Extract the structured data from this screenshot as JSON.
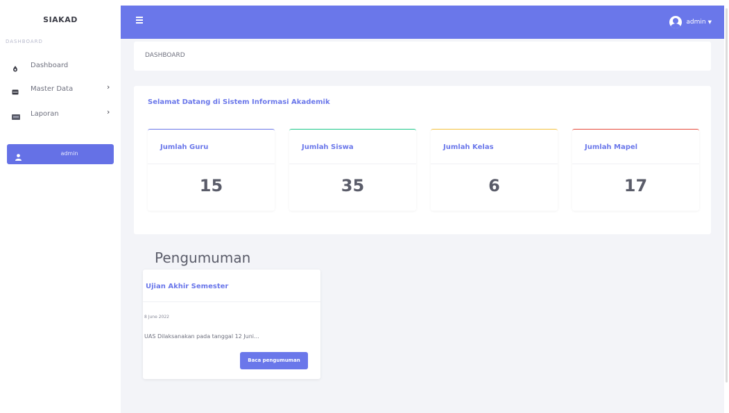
{
  "sidebar": {
    "brand": "SIAKAD",
    "heading": "DASHBOARD",
    "items": [
      {
        "label": "Dashboard",
        "icon": "tint-icon",
        "has_submenu": false
      },
      {
        "label": "Master Data",
        "icon": "database-icon",
        "has_submenu": true
      },
      {
        "label": "Laporan",
        "icon": "report-icon",
        "has_submenu": true
      }
    ],
    "user_button": "admin"
  },
  "topbar": {
    "menu_icon": "hamburger-icon",
    "user": "admin",
    "accent": "#6a77ea"
  },
  "breadcrumb": "DASHBOARD",
  "welcome": {
    "title": "Selamat Datang di Sistem Informasi Akademik",
    "stats": [
      {
        "label": "Jumlah Guru",
        "value": "15",
        "color": "#6a77ea"
      },
      {
        "label": "Jumlah Siswa",
        "value": "35",
        "color": "#1cc88a"
      },
      {
        "label": "Jumlah Kelas",
        "value": "6",
        "color": "#f6c23e"
      },
      {
        "label": "Jumlah Mapel",
        "value": "17",
        "color": "#e74a3b"
      }
    ]
  },
  "announcements": {
    "title": "Pengumuman",
    "items": [
      {
        "title": "Ujian Akhir Semester",
        "date": "8 June 2022",
        "excerpt": "UAS Dilaksanakan pada tanggal 12 Juni...",
        "button": "Baca pengumuman"
      }
    ]
  }
}
